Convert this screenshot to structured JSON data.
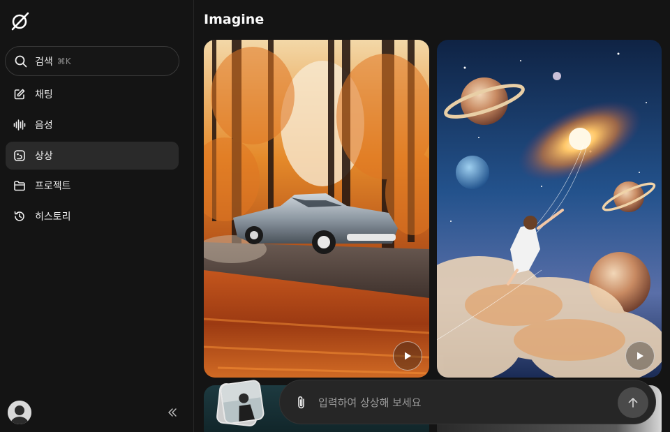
{
  "sidebar": {
    "search_label": "검색",
    "search_shortcut": "⌘K",
    "items": [
      {
        "label": "채팅",
        "icon": "edit-icon",
        "active": false
      },
      {
        "label": "음성",
        "icon": "voice-wave-icon",
        "active": false
      },
      {
        "label": "상상",
        "icon": "imagine-icon",
        "active": true
      },
      {
        "label": "프로젝트",
        "icon": "folder-icon",
        "active": false
      },
      {
        "label": "히스토리",
        "icon": "history-icon",
        "active": false
      }
    ]
  },
  "main": {
    "title": "Imagine"
  },
  "prompt": {
    "placeholder": "입력하여 상상해 보세요"
  },
  "colors": {
    "background": "#141414",
    "surface": "#262626",
    "active_item": "#2a2a2a",
    "text": "#f2f2f2"
  }
}
